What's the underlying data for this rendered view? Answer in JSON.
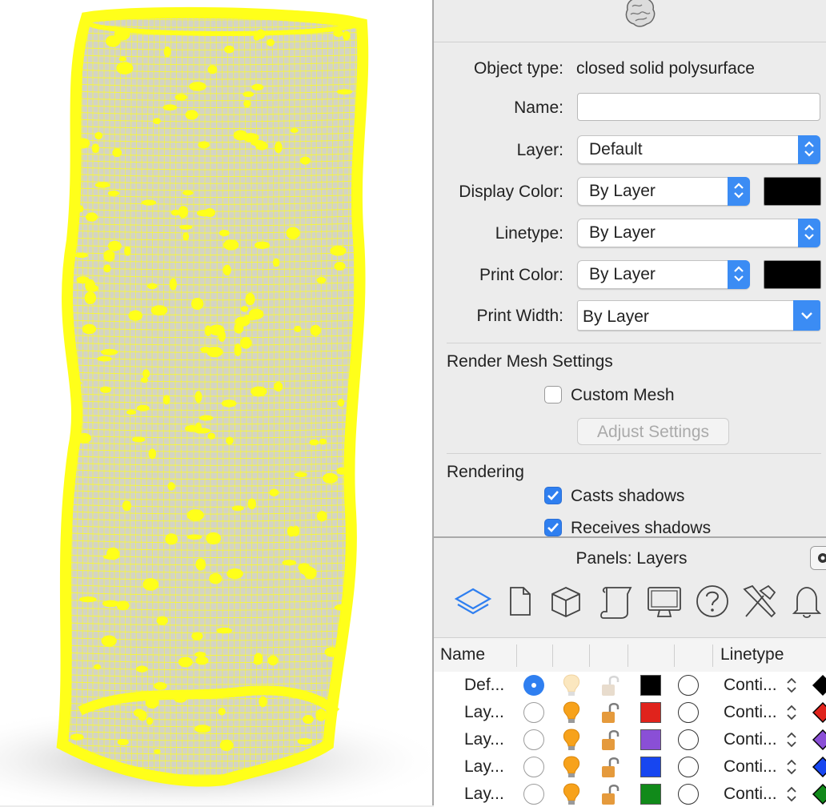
{
  "properties": {
    "object_type_label": "Object type:",
    "object_type_value": "closed solid polysurface",
    "name_label": "Name:",
    "name_value": "",
    "layer_label": "Layer:",
    "layer_value": "Default",
    "display_color_label": "Display Color:",
    "display_color_value": "By Layer",
    "display_color_swatch": "#000000",
    "linetype_label": "Linetype:",
    "linetype_value": "By Layer",
    "print_color_label": "Print Color:",
    "print_color_value": "By Layer",
    "print_color_swatch": "#000000",
    "print_width_label": "Print Width:",
    "print_width_value": "By Layer",
    "render_mesh_section": "Render Mesh Settings",
    "custom_mesh_label": "Custom Mesh",
    "custom_mesh_checked": false,
    "adjust_settings_label": "Adjust Settings",
    "rendering_section": "Rendering",
    "casts_shadows_label": "Casts shadows",
    "casts_shadows_checked": true,
    "receives_shadows_label": "Receives shadows",
    "receives_shadows_checked": true
  },
  "layers_panel": {
    "title": "Panels: Layers",
    "tabs": [
      "layers-icon",
      "document-icon",
      "cube-icon",
      "scroll-icon",
      "monitor-icon",
      "help-icon",
      "tools-icon",
      "bell-icon"
    ],
    "columns": {
      "name": "Name",
      "linetype": "Linetype"
    },
    "rows": [
      {
        "name": "Def...",
        "current": true,
        "bulb_on": false,
        "locked": false,
        "color": "#000000",
        "linetype": "Conti..."
      },
      {
        "name": "Lay...",
        "current": false,
        "bulb_on": true,
        "locked": false,
        "color": "#e0231c",
        "linetype": "Conti..."
      },
      {
        "name": "Lay...",
        "current": false,
        "bulb_on": true,
        "locked": false,
        "color": "#8a4fd6",
        "linetype": "Conti..."
      },
      {
        "name": "Lay...",
        "current": false,
        "bulb_on": true,
        "locked": false,
        "color": "#1746f0",
        "linetype": "Conti..."
      },
      {
        "name": "Lay...",
        "current": false,
        "bulb_on": true,
        "locked": false,
        "color": "#118a1a",
        "linetype": "Conti..."
      }
    ]
  },
  "viewport": {
    "object_color": "#ffff1a",
    "background": "#ffffff"
  }
}
